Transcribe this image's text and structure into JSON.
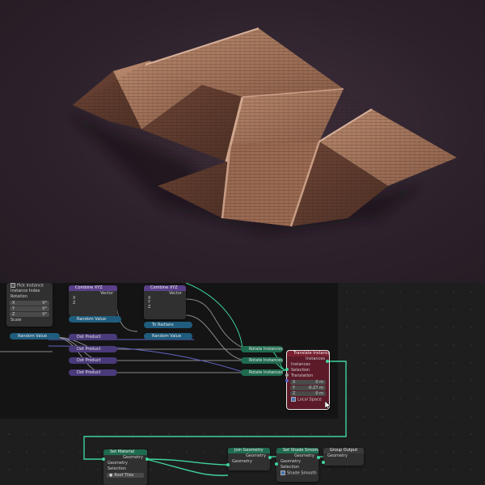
{
  "nodes": {
    "pick": {
      "pick_instance": "Pick Instance",
      "instance_index": "Instance Index",
      "rotation": "Rotation",
      "x_label": "X",
      "x_val": "0°",
      "y_label": "Y",
      "y_val": "0°",
      "z_label": "Z",
      "z_val": "0°",
      "scale": "Scale"
    },
    "combine1": {
      "title": "Combine XYZ",
      "vector": "Vector",
      "x": "X",
      "y": "Y",
      "z": "Z"
    },
    "combine2": {
      "title": "Combine XYZ",
      "vector": "Vector",
      "x": "X",
      "y": "Y",
      "z": "Z"
    },
    "random_value_1": "Random Value",
    "random_value_2": "Random Value",
    "random_value_3": "Random Value",
    "to_radians": "To Radians",
    "dot_products": [
      "Dot Product",
      "Dot Product",
      "Dot Product",
      "Dot Product"
    ],
    "rotate_instances": [
      "Rotate Instances",
      "Rotate Instances",
      "Rotate Instances"
    ],
    "translate": {
      "title": "Translate Instances",
      "instances_out": "Instances",
      "instances_in": "Instances",
      "selection": "Selection",
      "translation": "Translation",
      "x_label": "X",
      "x_val": "0 m",
      "y_label": "Y",
      "y_val": "-0.27 m",
      "z_label": "Z",
      "z_val": "0 m",
      "local_space": "Local Space"
    },
    "set_material": {
      "title": "Set Material",
      "geometry_out": "Geometry",
      "geometry_in": "Geometry",
      "selection": "Selection",
      "material": "Roof Tiles"
    },
    "join": {
      "title": "Join Geometry",
      "geometry_out": "Geometry",
      "geometry_in": "Geometry"
    },
    "shade": {
      "title": "Set Shade Smooth",
      "geometry_out": "Geometry",
      "geometry_in": "Geometry",
      "selection": "Selection",
      "shade_smooth": "Shade Smooth"
    },
    "output": {
      "title": "Group Output",
      "geometry": "Geometry"
    }
  },
  "colors": {
    "geometry_socket": "#3fd39b",
    "float_socket": "#a1a1a1",
    "vector_socket": "#6363c7",
    "geometry_header": "#1f6b4f",
    "translate_header": "#7a1f2f"
  }
}
